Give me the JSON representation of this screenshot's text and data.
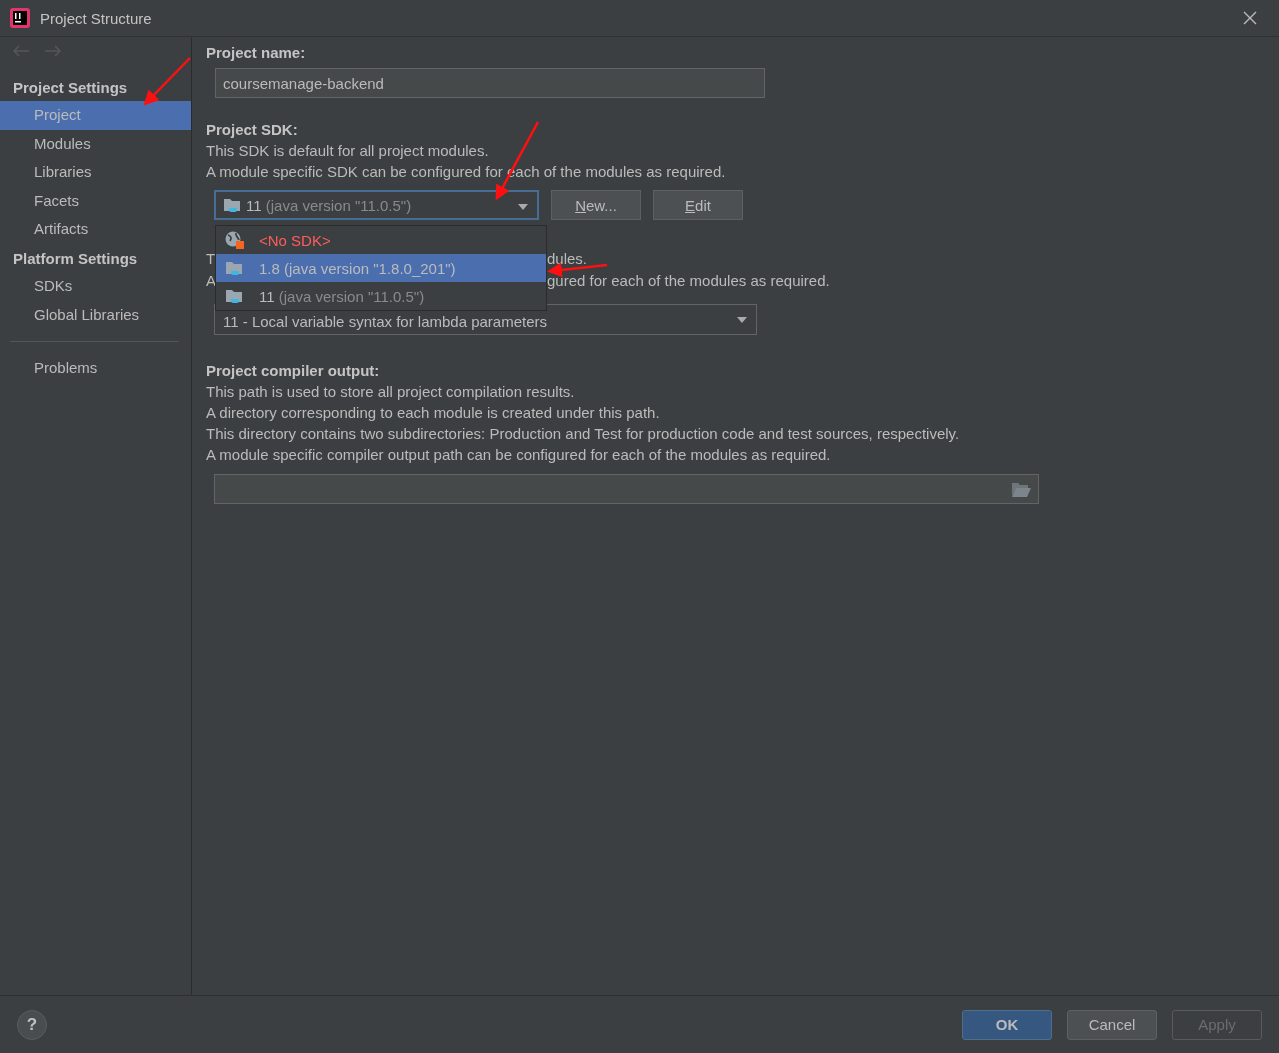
{
  "window": {
    "title": "Project Structure"
  },
  "sidebar": {
    "sections": [
      {
        "heading": "Project Settings",
        "items": [
          {
            "label": "Project",
            "selected": true
          },
          {
            "label": "Modules",
            "selected": false
          },
          {
            "label": "Libraries",
            "selected": false
          },
          {
            "label": "Facets",
            "selected": false
          },
          {
            "label": "Artifacts",
            "selected": false
          }
        ]
      },
      {
        "heading": "Platform Settings",
        "items": [
          {
            "label": "SDKs",
            "selected": false
          },
          {
            "label": "Global Libraries",
            "selected": false
          }
        ]
      }
    ],
    "problems": {
      "label": "Problems",
      "selected": false
    }
  },
  "project_name": {
    "label": "Project name:",
    "value": "coursemanage-backend"
  },
  "project_sdk": {
    "label": "Project SDK:",
    "description": [
      "This SDK is default for all project modules.",
      "A module specific SDK can be configured for each of the modules as required."
    ],
    "version": "11",
    "detail": "(java version \"11.0.5\")",
    "buttons": [
      {
        "label": "New...",
        "mnemonic": true
      },
      {
        "label": "Edit",
        "mnemonic": true
      }
    ]
  },
  "sdk_dropdown": {
    "options": [
      {
        "kind": "none",
        "version": "<No SDK>",
        "selected": false
      },
      {
        "kind": "jdk",
        "version": "1.8",
        "detail": "(java version \"1.8.0_201\")",
        "selected": true
      },
      {
        "kind": "jdk",
        "version": "11",
        "detail": "(java version \"11.0.5\")",
        "selected": false
      }
    ]
  },
  "language_level": {
    "lines": [
      [
        "T",
        "dules."
      ],
      [
        "A",
        "gured for each of the modules as required."
      ]
    ],
    "value": "11 - Local variable syntax for lambda parameters"
  },
  "compiler_output": {
    "label": "Project compiler output:",
    "description": [
      "This path is used to store all project compilation results.",
      "A directory corresponding to each module is created under this path.",
      "This directory contains two subdirectories: Production and Test for production code and test sources, respectively.",
      "A module specific compiler output path can be configured for each of the modules as required."
    ]
  },
  "footer": {
    "help": "?",
    "buttons": [
      {
        "label": "OK",
        "default": true,
        "disabled": false
      },
      {
        "label": "Cancel",
        "default": false,
        "disabled": false
      },
      {
        "label": "Apply",
        "default": false,
        "disabled": true
      }
    ]
  }
}
